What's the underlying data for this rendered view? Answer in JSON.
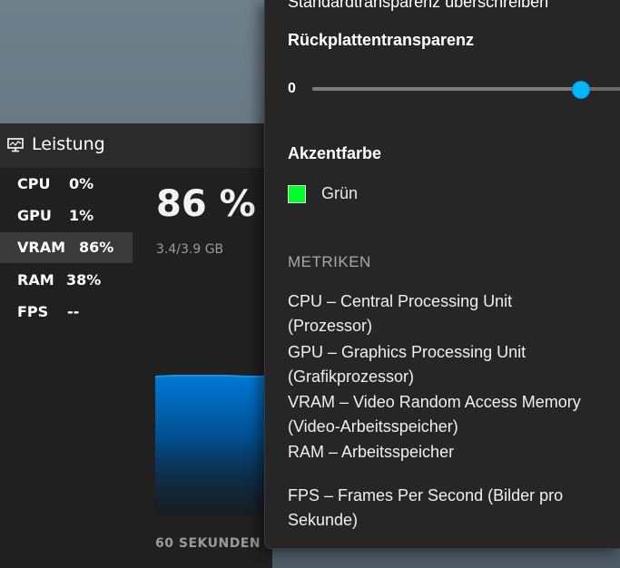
{
  "perf": {
    "title": "Leistung",
    "metrics": [
      {
        "name": "CPU",
        "value": "0%"
      },
      {
        "name": "GPU",
        "value": "1%"
      },
      {
        "name": "VRAM",
        "value": "86%"
      },
      {
        "name": "RAM",
        "value": "38%"
      },
      {
        "name": "FPS",
        "value": "--"
      }
    ],
    "selected_metric": "VRAM",
    "big_value": "86 %",
    "sub_value": "3.4/3.9 GB",
    "graph_footer": "60 SEKUNDEN",
    "graph_fill_level": 0.86,
    "graph_color": "#0078d7"
  },
  "settings": {
    "override_label": "Standardtransparenz überschreiben",
    "transparency_label": "Rückplattentransparenz",
    "slider_min_label": "0",
    "slider_level": 0.87,
    "slider_color": "#00b7ff",
    "accent_label": "Akzentfarbe",
    "accent_value": "Grün",
    "accent_color": "#00ff2a",
    "metrics_heading": "METRIKEN",
    "descriptions": {
      "cpu_line1": "CPU – Central Processing Unit",
      "cpu_line2": "(Prozessor)",
      "gpu_line1": "GPU – Graphics Processing Unit",
      "gpu_line2": "(Grafikprozessor)",
      "vram_line1": "VRAM – Video Random Access Memory",
      "vram_line2": "(Video-Arbeitsspeicher)",
      "ram_line1": "RAM – Arbeitsspeicher",
      "fps_line1": "FPS – Frames Per Second (Bilder pro",
      "fps_line2": "Sekunde)"
    }
  }
}
